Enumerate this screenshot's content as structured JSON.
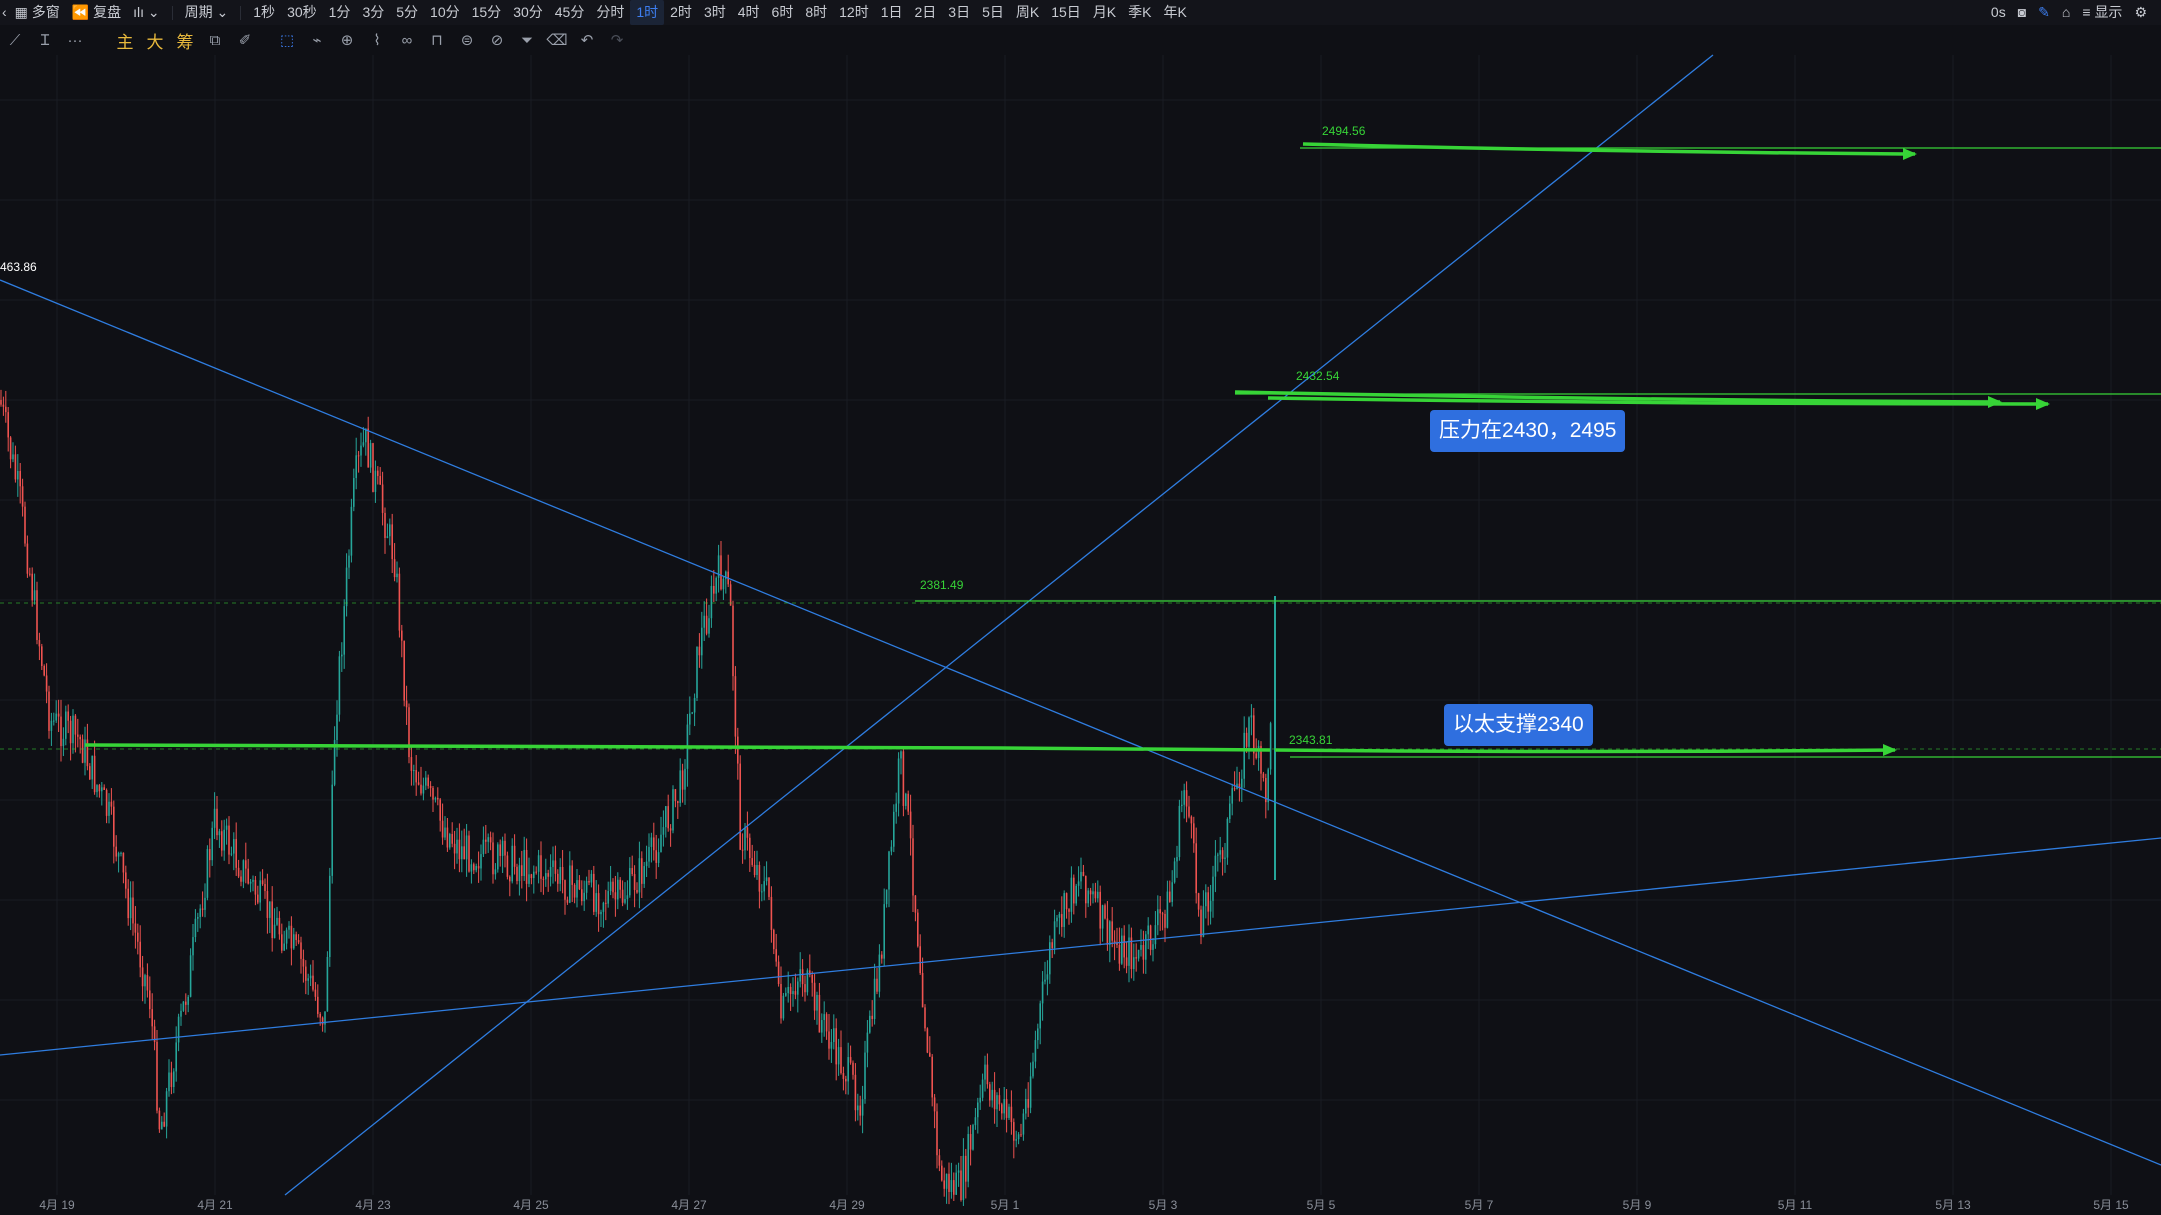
{
  "toolbar": {
    "left": {
      "multiwindow": "多窗",
      "adjust": "复盘",
      "period": "周期"
    },
    "periods": [
      "1秒",
      "30秒",
      "1分",
      "3分",
      "5分",
      "10分",
      "15分",
      "30分",
      "45分",
      "分时",
      "1时",
      "2时",
      "3时",
      "4时",
      "6时",
      "8时",
      "12时",
      "1日",
      "2日",
      "3日",
      "5日",
      "周K",
      "15日",
      "月K",
      "季K",
      "年K"
    ],
    "active_period": "1时",
    "right": {
      "countdown": "0s",
      "display": "显示"
    }
  },
  "drawing_toolbar": {
    "main": "主",
    "big": "大",
    "chip": "筹"
  },
  "chart": {
    "edge_price": "463.86",
    "price_labels": [
      "2494.56",
      "2432.54",
      "2381.49",
      "2343.81"
    ],
    "annotations": {
      "resistance": "压力在2430，2495",
      "support": "以太支撑2340"
    },
    "x_labels": [
      "4月 19",
      "4月 21",
      "4月 23",
      "4月 25",
      "4月 27",
      "4月 29",
      "5月 1",
      "5月 3",
      "5月 5",
      "5月 7",
      "5月 9",
      "5月 11",
      "5月 13",
      "5月 15"
    ]
  },
  "colors": {
    "background": "#0f1015",
    "up": "#26a69a",
    "down": "#ef5350",
    "trendline": "#2f7de0",
    "level": "#37d437",
    "badge": "#2f6fdf",
    "active": "#3d7ef0"
  },
  "icons": {
    "back": "back-arrow-icon",
    "grid": "grid-icon",
    "candle": "candle-type-icon",
    "camera": "camera-icon",
    "pen": "pen-icon",
    "settings": "gear-icon"
  }
}
